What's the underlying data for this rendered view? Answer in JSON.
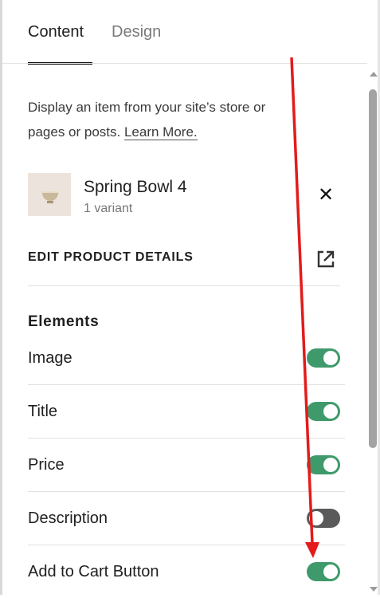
{
  "tabs": [
    {
      "label": "Content",
      "active": true
    },
    {
      "label": "Design",
      "active": false
    }
  ],
  "description": {
    "text": "Display an item from your site’s store or pages or posts. ",
    "link": "Learn More."
  },
  "product": {
    "name": "Spring Bowl 4",
    "variant": "1 variant",
    "remove_icon": "close-icon",
    "remove_glyph": "✕"
  },
  "edit_details": {
    "label": "EDIT PRODUCT DETAILS",
    "icon": "external-link-icon"
  },
  "elements": {
    "heading": "Elements",
    "items": [
      {
        "label": "Image",
        "on": true
      },
      {
        "label": "Title",
        "on": true
      },
      {
        "label": "Price",
        "on": true
      },
      {
        "label": "Description",
        "on": false
      },
      {
        "label": "Add to Cart Button",
        "on": true
      }
    ]
  },
  "colors": {
    "toggle_on": "#3f9a6b",
    "toggle_off": "#5a5a5a",
    "annotation_arrow": "#e31b1b"
  }
}
